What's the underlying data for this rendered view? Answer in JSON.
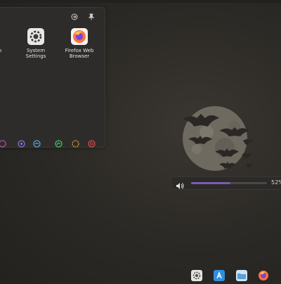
{
  "launcher": {
    "apps": [
      {
        "label_line1": "o",
        "label_line2": "",
        "icon": "partial-app-icon"
      },
      {
        "label_line1": "System",
        "label_line2": "Settings",
        "icon": "settings-icon"
      },
      {
        "label_line1": "Firefox Web",
        "label_line2": "Browser",
        "icon": "firefox-icon"
      }
    ],
    "favorites": [
      "app-icon-purple",
      "app-icon-violet",
      "app-icon-blue",
      "app-icon-green",
      "app-icon-amber",
      "app-icon-red"
    ]
  },
  "osd": {
    "percent_text": "52%",
    "volume": 0.52,
    "accent": "#7a5bb8"
  },
  "dock": {
    "items": [
      "system-settings-icon",
      "app-store-icon",
      "files-icon",
      "firefox-icon"
    ]
  },
  "wallpaper": {
    "subject": "bats over full moon"
  }
}
